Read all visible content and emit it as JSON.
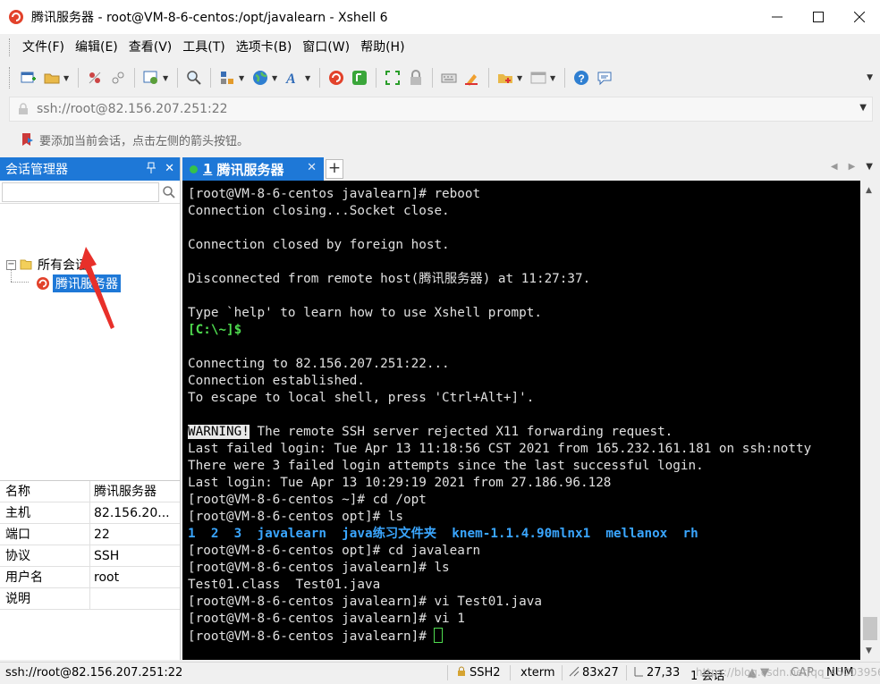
{
  "window": {
    "title": "腾讯服务器 - root@VM-8-6-centos:/opt/javalearn - Xshell 6",
    "minimize_glyph": "—",
    "maximize_glyph": "☐",
    "close_glyph": "✕"
  },
  "menu": {
    "items": [
      "文件(F)",
      "编辑(E)",
      "查看(V)",
      "工具(T)",
      "选项卡(B)",
      "窗口(W)",
      "帮助(H)"
    ]
  },
  "toolbar": {
    "icons": [
      "new-session-icon",
      "open-folder-icon",
      "disconnect-icon",
      "reconnect-icon",
      "properties-icon",
      "find-icon",
      "transfer-icon",
      "globe-icon",
      "font-icon",
      "xshell-icon",
      "xftp-icon",
      "fullscreen-icon",
      "lock-icon",
      "keyboard-icon",
      "highlight-icon",
      "add-folder-icon",
      "layout-icon",
      "help-icon",
      "chat-icon"
    ]
  },
  "address": {
    "value": "ssh://root@82.156.207.251:22"
  },
  "hint": {
    "text": "要添加当前会话，点击左侧的箭头按钮。"
  },
  "session_manager": {
    "title": "会话管理器",
    "pin_glyph": "ᴾ",
    "close_glyph": "✕",
    "search_placeholder": "",
    "tree": {
      "root_label": "所有会话",
      "root_toggle": "−",
      "session_label": "腾讯服务器"
    },
    "properties": [
      {
        "key": "名称",
        "value": "腾讯服务器"
      },
      {
        "key": "主机",
        "value": "82.156.20..."
      },
      {
        "key": "端口",
        "value": "22"
      },
      {
        "key": "协议",
        "value": "SSH"
      },
      {
        "key": "用户名",
        "value": "root"
      },
      {
        "key": "说明",
        "value": ""
      }
    ]
  },
  "tabs": {
    "active_number": "1",
    "active_label": "腾讯服务器",
    "close_glyph": "✕",
    "add_glyph": "+"
  },
  "terminal": {
    "lines": [
      "[root@VM-8-6-centos javalearn]# reboot",
      "Connection closing...Socket close.",
      "",
      "Connection closed by foreign host.",
      "",
      "Disconnected from remote host(腾讯服务器) at 11:27:37.",
      "",
      "Type `help' to learn how to use Xshell prompt.",
      "[C:\\~]$",
      "",
      "Connecting to 82.156.207.251:22...",
      "Connection established.",
      "To escape to local shell, press 'Ctrl+Alt+]'.",
      "",
      "WARNING!",
      "Last failed login: Tue Apr 13 11:18:56 CST 2021 from 165.232.161.181 on ssh:notty",
      "There were 3 failed login attempts since the last successful login.",
      "Last login: Tue Apr 13 10:29:19 2021 from 27.186.96.128",
      "[root@VM-8-6-centos ~]# cd /opt",
      "[root@VM-8-6-centos opt]# ls",
      "1  2  3  javalearn  java练习文件夹  knem-1.1.4.90mlnx1  mellanox  rh",
      "[root@VM-8-6-centos opt]# cd javalearn",
      "[root@VM-8-6-centos javalearn]# ls",
      "Test01.class  Test01.java",
      "[root@VM-8-6-centos javalearn]# vi Test01.java",
      "[root@VM-8-6-centos javalearn]# vi 1",
      "[root@VM-8-6-centos javalearn]# "
    ],
    "warning_rest": " The remote SSH server rejected X11 forwarding request."
  },
  "status": {
    "connection": "ssh://root@82.156.207.251:22",
    "protocol": "SSH2",
    "terminal_type": "xterm",
    "size": "83x27",
    "cursor_pos": "27,33",
    "sessions": "1 会话",
    "caps": "CAP",
    "num": "NUM",
    "watermark": "https://blog.csdn.net/qq_45003956"
  },
  "colors": {
    "accent": "#1e78d7",
    "terminal_bg": "#000000",
    "prompt_green": "#4fdc4f",
    "dir_blue": "#3aa6ff"
  }
}
